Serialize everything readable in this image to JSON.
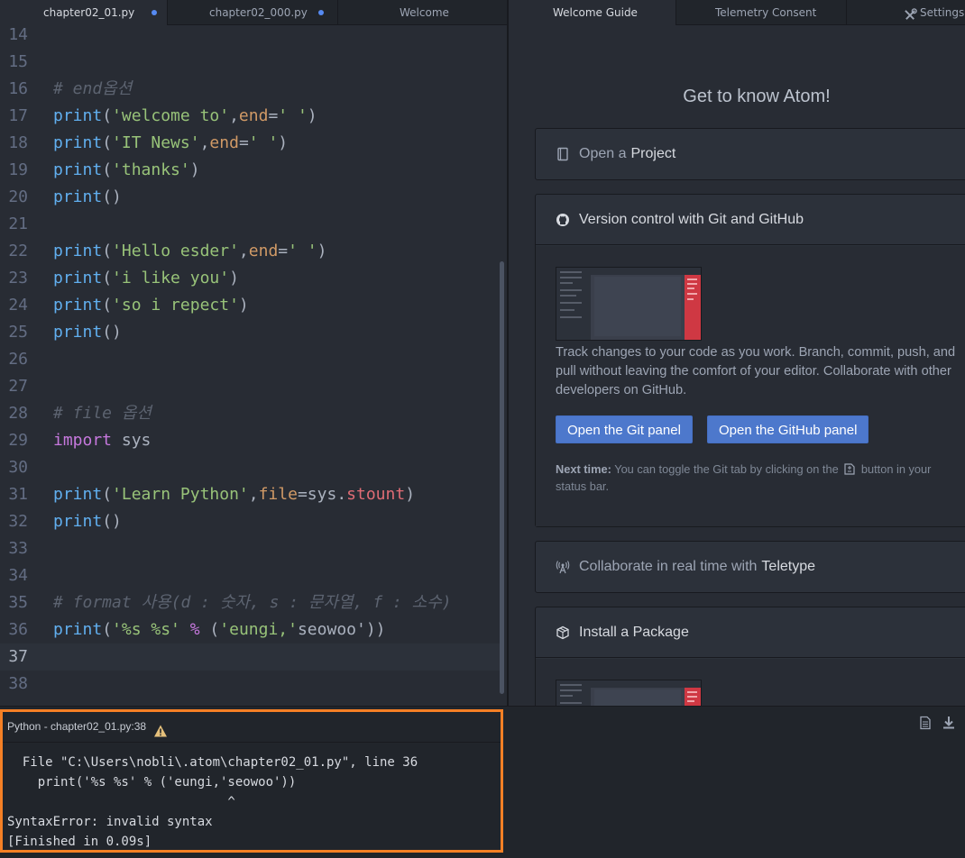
{
  "left_tabs": [
    {
      "title": "chapter02_01.py",
      "active": true,
      "modified": true
    },
    {
      "title": "chapter02_000.py",
      "active": false,
      "modified": true
    },
    {
      "title": "Welcome",
      "active": false,
      "modified": false
    }
  ],
  "right_tabs": [
    {
      "title": "Welcome Guide",
      "active": true
    },
    {
      "title": "Telemetry Consent",
      "active": false
    },
    {
      "title": "Settings",
      "active": false,
      "icon": "tools-icon"
    }
  ],
  "editor": {
    "cursor_line": 37,
    "lines": [
      {
        "n": "14",
        "tokens": []
      },
      {
        "n": "15",
        "tokens": []
      },
      {
        "n": "16",
        "tokens": [
          {
            "t": "# end옵션",
            "c": "cm"
          }
        ]
      },
      {
        "n": "17",
        "tokens": [
          {
            "t": "print",
            "c": "fn"
          },
          {
            "t": "(",
            "c": "pl"
          },
          {
            "t": "'welcome to'",
            "c": "str"
          },
          {
            "t": ",",
            "c": "pl"
          },
          {
            "t": "end",
            "c": "attr"
          },
          {
            "t": "=",
            "c": "pl"
          },
          {
            "t": "' '",
            "c": "str"
          },
          {
            "t": ")",
            "c": "pl"
          }
        ]
      },
      {
        "n": "18",
        "tokens": [
          {
            "t": "print",
            "c": "fn"
          },
          {
            "t": "(",
            "c": "pl"
          },
          {
            "t": "'IT News'",
            "c": "str"
          },
          {
            "t": ",",
            "c": "pl"
          },
          {
            "t": "end",
            "c": "attr"
          },
          {
            "t": "=",
            "c": "pl"
          },
          {
            "t": "' '",
            "c": "str"
          },
          {
            "t": ")",
            "c": "pl"
          }
        ]
      },
      {
        "n": "19",
        "tokens": [
          {
            "t": "print",
            "c": "fn"
          },
          {
            "t": "(",
            "c": "pl"
          },
          {
            "t": "'thanks'",
            "c": "str"
          },
          {
            "t": ")",
            "c": "pl"
          }
        ]
      },
      {
        "n": "20",
        "tokens": [
          {
            "t": "print",
            "c": "fn"
          },
          {
            "t": "()",
            "c": "pl"
          }
        ]
      },
      {
        "n": "21",
        "tokens": []
      },
      {
        "n": "22",
        "tokens": [
          {
            "t": "print",
            "c": "fn"
          },
          {
            "t": "(",
            "c": "pl"
          },
          {
            "t": "'Hello esder'",
            "c": "str"
          },
          {
            "t": ",",
            "c": "pl"
          },
          {
            "t": "end",
            "c": "attr"
          },
          {
            "t": "=",
            "c": "pl"
          },
          {
            "t": "' '",
            "c": "str"
          },
          {
            "t": ")",
            "c": "pl"
          }
        ]
      },
      {
        "n": "23",
        "tokens": [
          {
            "t": "print",
            "c": "fn"
          },
          {
            "t": "(",
            "c": "pl"
          },
          {
            "t": "'i like you'",
            "c": "str"
          },
          {
            "t": ")",
            "c": "pl"
          }
        ]
      },
      {
        "n": "24",
        "tokens": [
          {
            "t": "print",
            "c": "fn"
          },
          {
            "t": "(",
            "c": "pl"
          },
          {
            "t": "'so i repect'",
            "c": "str"
          },
          {
            "t": ")",
            "c": "pl"
          }
        ]
      },
      {
        "n": "25",
        "tokens": [
          {
            "t": "print",
            "c": "fn"
          },
          {
            "t": "()",
            "c": "pl"
          }
        ]
      },
      {
        "n": "26",
        "tokens": []
      },
      {
        "n": "27",
        "tokens": []
      },
      {
        "n": "28",
        "tokens": [
          {
            "t": "# file 옵션",
            "c": "cm"
          }
        ]
      },
      {
        "n": "29",
        "tokens": [
          {
            "t": "import",
            "c": "kw"
          },
          {
            "t": " sys",
            "c": "pl"
          }
        ]
      },
      {
        "n": "30",
        "tokens": []
      },
      {
        "n": "31",
        "tokens": [
          {
            "t": "print",
            "c": "fn"
          },
          {
            "t": "(",
            "c": "pl"
          },
          {
            "t": "'Learn Python'",
            "c": "str"
          },
          {
            "t": ",",
            "c": "pl"
          },
          {
            "t": "file",
            "c": "attr"
          },
          {
            "t": "=",
            "c": "pl"
          },
          {
            "t": "sys",
            "c": "pl"
          },
          {
            "t": ".",
            "c": "pl"
          },
          {
            "t": "stount",
            "c": "prop"
          },
          {
            "t": ")",
            "c": "pl"
          }
        ]
      },
      {
        "n": "32",
        "tokens": [
          {
            "t": "print",
            "c": "fn"
          },
          {
            "t": "()",
            "c": "pl"
          }
        ]
      },
      {
        "n": "33",
        "tokens": []
      },
      {
        "n": "34",
        "tokens": []
      },
      {
        "n": "35",
        "tokens": [
          {
            "t": "# format 사용(d : 숫자, s : 문자열, f : 소수)",
            "c": "cm"
          }
        ]
      },
      {
        "n": "36",
        "tokens": [
          {
            "t": "print",
            "c": "fn"
          },
          {
            "t": "(",
            "c": "pl"
          },
          {
            "t": "'%s %s'",
            "c": "str"
          },
          {
            "t": " ",
            "c": "pl"
          },
          {
            "t": "%",
            "c": "op"
          },
          {
            "t": " (",
            "c": "pl"
          },
          {
            "t": "'eungi,'",
            "c": "str"
          },
          {
            "t": "seowoo",
            "c": "pl"
          },
          {
            "t": "'))",
            "c": "pl"
          }
        ]
      },
      {
        "n": "37",
        "tokens": []
      },
      {
        "n": "38",
        "tokens": []
      }
    ]
  },
  "guide": {
    "title": "Get to know Atom!",
    "sections": {
      "project": {
        "prefix": "Open a",
        "strong": "Project",
        "icon": "repo-icon"
      },
      "git": {
        "title": "Version control with Git and GitHub",
        "icon": "github-icon",
        "description": "Track changes to your code as you work. Branch, commit, push, and pull without leaving the comfort of your editor. Collaborate with other developers on GitHub.",
        "button_git": "Open the Git panel",
        "button_github": "Open the GitHub panel",
        "hint_label": "Next time:",
        "hint_before": "You can toggle the Git tab by clicking on the",
        "hint_after": "button in your status bar."
      },
      "teletype": {
        "prefix": "Collaborate in real time with",
        "strong": "Teletype",
        "icon": "radio-tower-icon"
      },
      "package": {
        "title": "Install a Package",
        "icon": "package-icon"
      }
    }
  },
  "output": {
    "header": "Python - chapter02_01.py:38",
    "lines": [
      "  File \"C:\\Users\\nobli\\.atom\\chapter02_01.py\", line 36",
      "    print('%s %s' % ('eungi,'seowoo'))",
      "                             ^",
      "SyntaxError: invalid syntax",
      "[Finished in 0.09s]"
    ]
  },
  "colors": {
    "accent": "#4d78cc",
    "highlight_border": "#f58025",
    "modified_dot": "#568af2"
  }
}
